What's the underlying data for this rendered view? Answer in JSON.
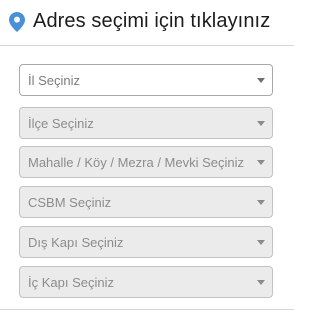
{
  "header": {
    "icon": "map-pin-icon",
    "title": "Adres seçimi için tıklayınız",
    "accent_color": "#4a90d9"
  },
  "selects": [
    {
      "id": "il",
      "placeholder": "İl Seçiniz",
      "enabled": true
    },
    {
      "id": "ilce",
      "placeholder": "İlçe Seçiniz",
      "enabled": false
    },
    {
      "id": "mahalle",
      "placeholder": "Mahalle / Köy / Mezra / Mevki Seçiniz",
      "enabled": false
    },
    {
      "id": "csbm",
      "placeholder": "CSBM Seçiniz",
      "enabled": false
    },
    {
      "id": "dis-kapi",
      "placeholder": "Dış Kapı Seçiniz",
      "enabled": false
    },
    {
      "id": "ic-kapi",
      "placeholder": "İç Kapı Seçiniz",
      "enabled": false
    }
  ],
  "colors": {
    "enabled_bg": "#ffffff",
    "disabled_bg": "#ebebeb",
    "placeholder_text": "#8c8c8c"
  }
}
